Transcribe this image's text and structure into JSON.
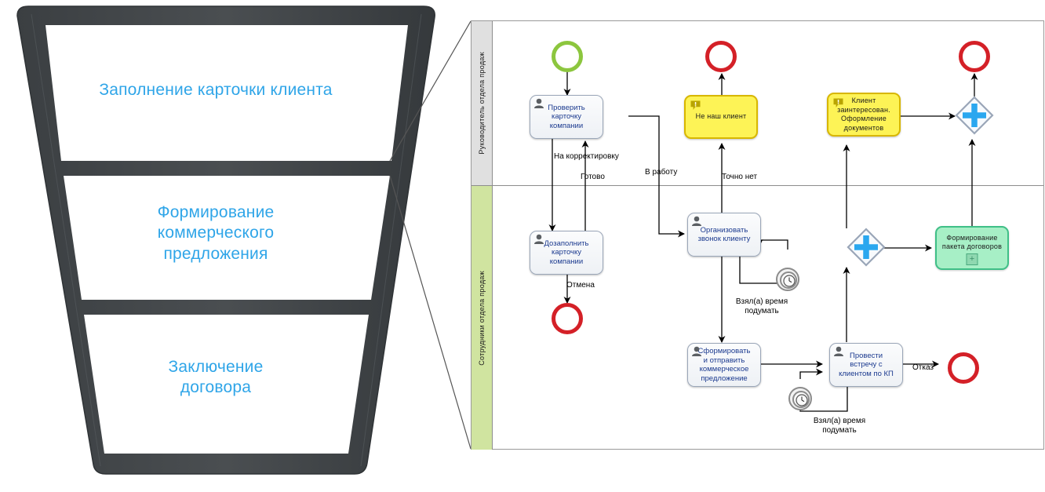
{
  "funnel": {
    "name": "sales-funnel",
    "stages": [
      {
        "id": "stage-1",
        "label": "Заполнение карточки клиента"
      },
      {
        "id": "stage-2",
        "label": "Формирование\nкоммерческого\nпредложения"
      },
      {
        "id": "stage-3",
        "label": "Заключение\nдоговора"
      }
    ],
    "label_color": "#2FA5E8",
    "body_color": "#444444"
  },
  "diagram": {
    "type": "bpmn",
    "lanes": [
      {
        "id": "lane-manager",
        "label": "Руководитель отдела продаж",
        "color": "#e0e0e0"
      },
      {
        "id": "lane-staff",
        "label": "Сотрудники отдела продаж",
        "color": "#d0e4a0"
      }
    ],
    "nodes": {
      "start_event": {
        "label": "",
        "kind": "start-event",
        "color": "#8cc63e"
      },
      "task_check_card": {
        "label": "Проверить\nкарточку\nкомпании",
        "kind": "user-task"
      },
      "task_fill_card": {
        "label": "Дозаполнить\nкарточку\nкомпании",
        "kind": "user-task"
      },
      "task_call": {
        "label": "Организовать\nзвонок клиенту",
        "kind": "user-task"
      },
      "task_offer": {
        "label": "Сформировать\nи отправить\nкоммерческое\nпредложение",
        "kind": "user-task"
      },
      "task_meeting": {
        "label": "Провести\nвстречу с\nклиентом по КП",
        "kind": "user-task"
      },
      "note_not_client": {
        "label": "Не наш клиент",
        "kind": "annotation",
        "color": "#fdf356"
      },
      "note_interested": {
        "label": "Клиент\nзаинтересован.\nОформление\nдокументов",
        "kind": "annotation",
        "color": "#fdf356"
      },
      "subprocess_contracts": {
        "label": "Формирование\nпакета договоров",
        "kind": "subprocess",
        "color": "#a7efc6",
        "marker": "+"
      },
      "gateway_parallel_1": {
        "label": "",
        "kind": "parallel-gateway",
        "marker": "+"
      },
      "gateway_parallel_2": {
        "label": "",
        "kind": "parallel-gateway",
        "marker": "+"
      },
      "end_cancel": {
        "label": "",
        "kind": "end-event",
        "color": "#d42027"
      },
      "end_not_client": {
        "label": "",
        "kind": "end-event",
        "color": "#d42027"
      },
      "end_done": {
        "label": "",
        "kind": "end-event",
        "color": "#d42027"
      },
      "end_refusal": {
        "label": "",
        "kind": "end-event",
        "color": "#d42027"
      },
      "timer_call": {
        "label": "",
        "kind": "timer-boundary-event"
      },
      "timer_meeting": {
        "label": "",
        "kind": "timer-boundary-event"
      }
    },
    "edge_labels": {
      "correction": "На корректировку",
      "ready": "Готово",
      "to_work": "В работу",
      "definitely_no": "Точно нет",
      "cancel": "Отмена",
      "think_call": "Взял(а)  время\nподумать",
      "think_meeting": "Взял(а)  время\nподумать",
      "refusal": "Отказ"
    }
  }
}
